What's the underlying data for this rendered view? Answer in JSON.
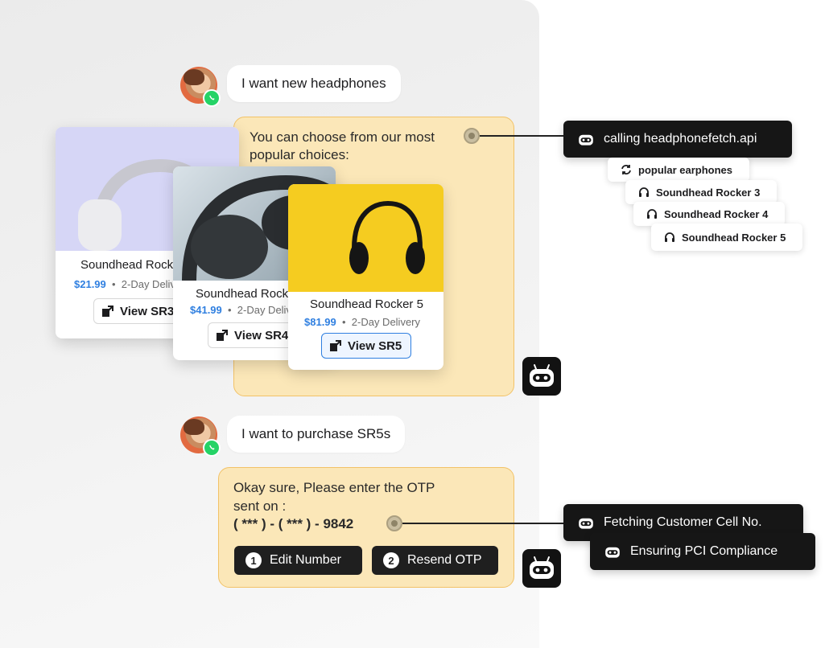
{
  "chat": {
    "msg1": "I want new headphones",
    "bot1_line1": "You can choose from our most",
    "bot1_line2": "popular choices:",
    "msg2": "I want to purchase SR5s",
    "bot2_line1": "Okay sure, Please enter the OTP",
    "bot2_line2": "sent on :",
    "bot2_phone": "( *** ) - ( *** ) - 9842"
  },
  "products": [
    {
      "title": "Soundhead Rocker 3",
      "price": "$21.99",
      "delivery": "2-Day Delivery",
      "button": "View SR3"
    },
    {
      "title": "Soundhead Rocker 4",
      "price": "$41.99",
      "delivery": "2-Day Delivery",
      "button": "View SR4"
    },
    {
      "title": "Soundhead Rocker 5",
      "price": "$81.99",
      "delivery": "2-Day Delivery",
      "button": "View SR5"
    }
  ],
  "actions": {
    "edit": {
      "number": "1",
      "label": "Edit Number"
    },
    "resend": {
      "number": "2",
      "label": "Resend OTP"
    }
  },
  "process1": {
    "api": "calling headphonefetch.api",
    "steps": [
      "popular earphones",
      "Soundhead Rocker 3",
      "Soundhead Rocker 4",
      "Soundhead Rocker 5"
    ]
  },
  "process2": {
    "steps": [
      "Fetching Customer Cell No.",
      "Ensuring PCI Compliance"
    ]
  },
  "colors": {
    "bot_bubble": "#fbe7b8",
    "bot_border": "#f2c267",
    "price": "#2f7fe0",
    "whatsapp": "#25d366"
  },
  "icons": [
    "avatar",
    "whatsapp-icon",
    "robot-icon",
    "refresh-icon",
    "headphones-icon",
    "external-link-icon"
  ]
}
